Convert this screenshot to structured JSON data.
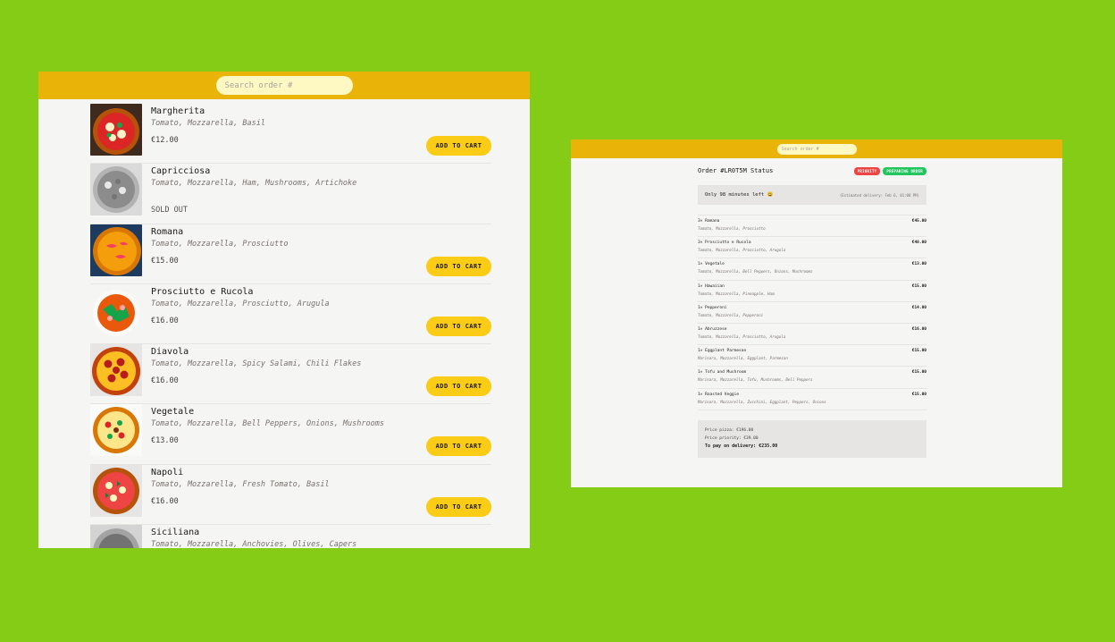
{
  "menu_window": {
    "search": {
      "placeholder": "Search order #"
    },
    "add_label": "ADD TO CART",
    "sold_out_label": "SOLD OUT",
    "items": [
      {
        "name": "Margherita",
        "ingredients": "Tomato, Mozzarella, Basil",
        "price": "€12.00",
        "sold_out": false
      },
      {
        "name": "Capricciosa",
        "ingredients": "Tomato, Mozzarella, Ham, Mushrooms, Artichoke",
        "price": "",
        "sold_out": true
      },
      {
        "name": "Romana",
        "ingredients": "Tomato, Mozzarella, Prosciutto",
        "price": "€15.00",
        "sold_out": false
      },
      {
        "name": "Prosciutto e Rucola",
        "ingredients": "Tomato, Mozzarella, Prosciutto, Arugula",
        "price": "€16.00",
        "sold_out": false
      },
      {
        "name": "Diavola",
        "ingredients": "Tomato, Mozzarella, Spicy Salami, Chili Flakes",
        "price": "€16.00",
        "sold_out": false
      },
      {
        "name": "Vegetale",
        "ingredients": "Tomato, Mozzarella, Bell Peppers, Onions, Mushrooms",
        "price": "€13.00",
        "sold_out": false
      },
      {
        "name": "Napoli",
        "ingredients": "Tomato, Mozzarella, Fresh Tomato, Basil",
        "price": "€16.00",
        "sold_out": false
      },
      {
        "name": "Siciliana",
        "ingredients": "Tomato, Mozzarella, Anchovies, Olives, Capers",
        "price": "",
        "sold_out": false
      }
    ]
  },
  "order_window": {
    "search": {
      "placeholder": "Search order #"
    },
    "title": "Order #LR0T5M Status",
    "badges": {
      "priority": "PRIORITY",
      "status": "PREPARING ORDER"
    },
    "time_left": "Only 98 minutes left 😃",
    "eta": "(Estimated delivery: Feb 6, 01:08 PM)",
    "items": [
      {
        "qty_name": "3× Romana",
        "ingredients": "Tomato, Mozzarella, Prosciutto",
        "price": "€45.00"
      },
      {
        "qty_name": "3× Prosciutto e Rucola",
        "ingredients": "Tomato, Mozzarella, Prosciutto, Arugula",
        "price": "€48.00"
      },
      {
        "qty_name": "1× Vegetale",
        "ingredients": "Tomato, Mozzarella, Bell Peppers, Onions, Mushrooms",
        "price": "€13.00"
      },
      {
        "qty_name": "1× Hawaiian",
        "ingredients": "Tomato, Mozzarella, Pineapple, Ham",
        "price": "€15.00"
      },
      {
        "qty_name": "1× Pepperoni",
        "ingredients": "Tomato, Mozzarella, Pepperoni",
        "price": "€14.00"
      },
      {
        "qty_name": "1× Abruzzese",
        "ingredients": "Tomato, Mozzarella, Prosciutto, Arugula",
        "price": "€16.00"
      },
      {
        "qty_name": "1× Eggplant Parmesan",
        "ingredients": "Marinara, Mozzarella, Eggplant, Parmesan",
        "price": "€15.00"
      },
      {
        "qty_name": "1× Tofu and Mushroom",
        "ingredients": "Marinara, Mozzarella, Tofu, Mushrooms, Bell Peppers",
        "price": "€15.00"
      },
      {
        "qty_name": "1× Roasted Veggie",
        "ingredients": "Marinara, Mozzarella, Zucchini, Eggplant, Peppers, Onions",
        "price": "€15.00"
      }
    ],
    "totals": {
      "price_pizza": "Price pizza: €196.00",
      "price_priority": "Price priority: €39.00",
      "to_pay": "To pay on delivery: €235.00"
    }
  },
  "colors": {
    "background": "#84cc16",
    "header": "#eab308",
    "button": "#facc15",
    "priority": "#ef4444",
    "status": "#22c55e"
  }
}
